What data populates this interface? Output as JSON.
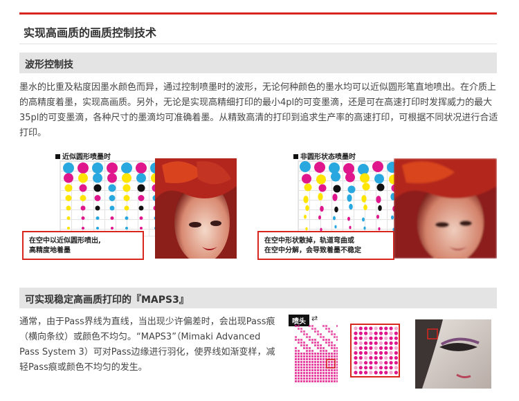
{
  "page_title": "实现高画质的画质控制技术",
  "section1": {
    "heading": "波形控制技",
    "paragraph": "墨水的比重及粘度因墨水颜色而异，通过控制喷墨时的波形，无论何种颜色的墨水均可以近似圆形笔直地喷出。在介质上的高精度着墨，实现高画质。另外，无论是实现高精细打印的最小4pl的可变墨滴，还是可在高速打印时发挥威力的最大35pl的可变墨滴，各种尺寸的墨滴均可准确着墨。从精致高清的打印到追求生产率的高速打印，可根据不同状况进行合适打印。",
    "figure_left": {
      "label": "近似圆形喷墨时",
      "callout_line1": "在空中以近似圆形喷出,",
      "callout_line2": "高精度地着墨"
    },
    "figure_right": {
      "label": "非圆形状态喷墨时",
      "callout_line1": "在空中形状散掉，轨道弯曲或",
      "callout_line2": "在空中分解，会导致着墨不稳定"
    }
  },
  "section2": {
    "heading": "可实现稳定高画质打印的『MAPS3』",
    "paragraph": "通常，由于Pass界线为直线，当出现少许偏差时，会出现Pass痕（横向条纹）或颜色不均匀。“MAPS3”（Mimaki Advanced Pass System 3）可对Pass边缘进行羽化，使界线如渐变样，减轻Pass痕或颜色不均匀的发生。",
    "printhead_label": "喷头",
    "arrow_icon": "double-arrow-icon"
  },
  "colors": {
    "accent": "#d7261e",
    "section_bar": "#e4e4e4",
    "cyan": "#29a8e0",
    "magenta": "#e0168c",
    "yellow": "#ffe500",
    "black": "#111111"
  }
}
